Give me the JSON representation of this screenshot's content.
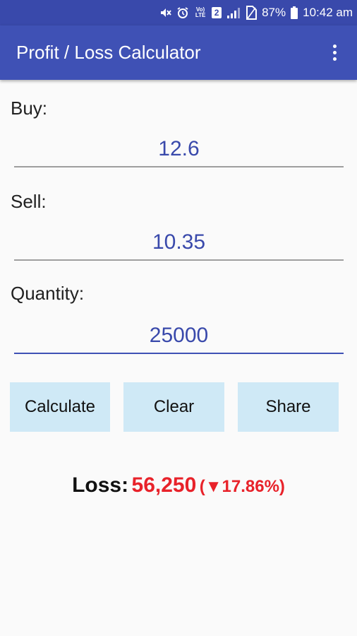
{
  "status_bar": {
    "battery": "87%",
    "time": "10:42 am",
    "network_label": "Vo) LTE",
    "sim_badge": "2"
  },
  "app_bar": {
    "title": "Profit / Loss Calculator"
  },
  "form": {
    "buy": {
      "label": "Buy:",
      "value": "12.6"
    },
    "sell": {
      "label": "Sell:",
      "value": "10.35"
    },
    "quantity": {
      "label": "Quantity:",
      "value": "25000"
    }
  },
  "buttons": {
    "calculate": "Calculate",
    "clear": "Clear",
    "share": "Share"
  },
  "result": {
    "label": "Loss:",
    "value": "56,250",
    "percent_open": "(",
    "arrow": "▼",
    "percent": "17.86%",
    "percent_close": ")"
  },
  "colors": {
    "app_bar": "#3f51b5",
    "status_bar": "#3949ab",
    "input_text": "#3949ab",
    "button_bg": "#cfe9f6",
    "loss": "#e8222a"
  }
}
